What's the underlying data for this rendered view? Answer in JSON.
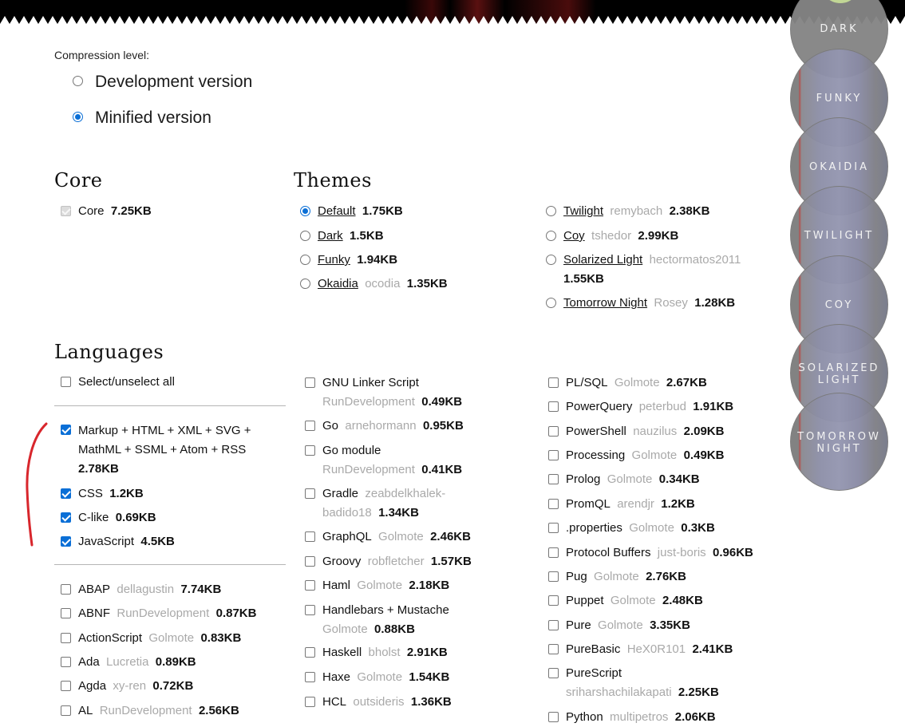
{
  "compression": {
    "label": "Compression level:",
    "options": [
      {
        "label": "Development version",
        "selected": false
      },
      {
        "label": "Minified version",
        "selected": true
      }
    ]
  },
  "core": {
    "heading": "Core",
    "item": {
      "name": "Core",
      "size": "7.25KB"
    }
  },
  "themes": {
    "heading": "Themes",
    "col1": [
      {
        "name": "Default",
        "author": "",
        "size": "1.75KB",
        "selected": true
      },
      {
        "name": "Dark",
        "author": "",
        "size": "1.5KB"
      },
      {
        "name": "Funky",
        "author": "",
        "size": "1.94KB"
      },
      {
        "name": "Okaidia",
        "author": "ocodia",
        "size": "1.35KB"
      }
    ],
    "col2": [
      {
        "name": "Twilight",
        "author": "remybach",
        "size": "2.38KB"
      },
      {
        "name": "Coy",
        "author": "tshedor",
        "size": "2.99KB"
      },
      {
        "name": "Solarized Light",
        "author": "hectormatos2011",
        "size": "1.55KB"
      },
      {
        "name": "Tomorrow Night",
        "author": "Rosey",
        "size": "1.28KB"
      }
    ]
  },
  "languages": {
    "heading": "Languages",
    "select_all": "Select/unselect all",
    "markup": {
      "name": "Markup + HTML + XML + SVG +",
      "name2": "MathML + SSML + Atom + RSS",
      "size": "2.78KB"
    },
    "col1_checked": [
      {
        "name": "CSS",
        "size": "1.2KB"
      },
      {
        "name": "C-like",
        "size": "0.69KB"
      },
      {
        "name": "JavaScript",
        "size": "4.5KB"
      }
    ],
    "col1": [
      {
        "name": "ABAP",
        "author": "dellagustin",
        "size": "7.74KB"
      },
      {
        "name": "ABNF",
        "author": "RunDevelopment",
        "size": "0.87KB"
      },
      {
        "name": "ActionScript",
        "author": "Golmote",
        "size": "0.83KB"
      },
      {
        "name": "Ada",
        "author": "Lucretia",
        "size": "0.89KB"
      },
      {
        "name": "Agda",
        "author": "xy-ren",
        "size": "0.72KB"
      },
      {
        "name": "AL",
        "author": "RunDevelopment",
        "size": "2.56KB"
      }
    ],
    "col2": [
      {
        "name": "GNU Linker Script",
        "author": "RunDevelopment",
        "size": "0.49KB"
      },
      {
        "name": "Go",
        "author": "arnehormann",
        "size": "0.95KB"
      },
      {
        "name": "Go module",
        "author": "RunDevelopment",
        "size": "0.41KB"
      },
      {
        "name": "Gradle",
        "author": "zeabdelkhalek-",
        "author2": "badido18",
        "size": "1.34KB"
      },
      {
        "name": "GraphQL",
        "author": "Golmote",
        "size": "2.46KB"
      },
      {
        "name": "Groovy",
        "author": "robfletcher",
        "size": "1.57KB"
      },
      {
        "name": "Haml",
        "author": "Golmote",
        "size": "2.18KB"
      },
      {
        "name": "Handlebars + Mustache",
        "author": "Golmote",
        "size": "0.88KB"
      },
      {
        "name": "Haskell",
        "author": "bholst",
        "size": "2.91KB"
      },
      {
        "name": "Haxe",
        "author": "Golmote",
        "size": "1.54KB"
      },
      {
        "name": "HCL",
        "author": "outsideris",
        "size": "1.36KB"
      }
    ],
    "col3": [
      {
        "name": "PL/SQL",
        "author": "Golmote",
        "size": "2.67KB"
      },
      {
        "name": "PowerQuery",
        "author": "peterbud",
        "size": "1.91KB"
      },
      {
        "name": "PowerShell",
        "author": "nauzilus",
        "size": "2.09KB"
      },
      {
        "name": "Processing",
        "author": "Golmote",
        "size": "0.49KB"
      },
      {
        "name": "Prolog",
        "author": "Golmote",
        "size": "0.34KB"
      },
      {
        "name": "PromQL",
        "author": "arendjr",
        "size": "1.2KB"
      },
      {
        "name": ".properties",
        "author": "Golmote",
        "size": "0.3KB"
      },
      {
        "name": "Protocol Buffers",
        "author": "just-boris",
        "size": "0.96KB"
      },
      {
        "name": "Pug",
        "author": "Golmote",
        "size": "2.76KB"
      },
      {
        "name": "Puppet",
        "author": "Golmote",
        "size": "2.48KB"
      },
      {
        "name": "Pure",
        "author": "Golmote",
        "size": "3.35KB"
      },
      {
        "name": "PureBasic",
        "author": "HeX0R101",
        "size": "2.41KB"
      },
      {
        "name": "PureScript",
        "author": "sriharshachilakapati",
        "size": "2.25KB"
      },
      {
        "name": "Python",
        "author": "multipetros",
        "size": "2.06KB"
      }
    ]
  },
  "theme_switcher": [
    "DARK",
    "FUNKY",
    "OKAIDIA",
    "TWILIGHT",
    "COY",
    "SOLARIZED",
    "LIGHT",
    "TOMORROW",
    "NIGHT"
  ],
  "colors": {
    "accent": "#0b6fd6",
    "annotation": "#d8262c",
    "muted": "#a9a9a9"
  }
}
